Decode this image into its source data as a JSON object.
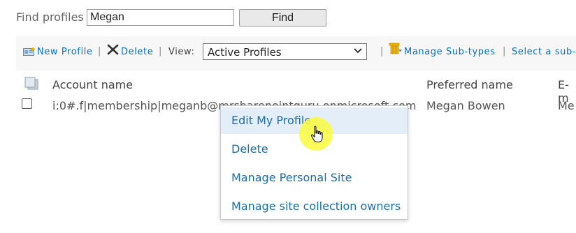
{
  "find": {
    "label": "Find profiles",
    "value": "Megan",
    "button": "Find"
  },
  "toolbar": {
    "new_profile": "New Profile",
    "delete": "Delete",
    "view_label": "View:",
    "view_selected": "Active Profiles",
    "manage_subtypes": "Manage Sub-types",
    "select_subtype": "Select a sub-",
    "separator": "|"
  },
  "table": {
    "headers": [
      "Account name",
      "Preferred name",
      "E-m"
    ],
    "rows": [
      {
        "account": "i:0#.f|membership|meganb@mrsharepointguru.onmicrosoft.com",
        "preferred": "Megan Bowen",
        "email": "Me"
      }
    ]
  },
  "context_menu": {
    "items": [
      "Edit My Profile",
      "Delete",
      "Manage Personal Site",
      "Manage site collection owners"
    ]
  },
  "colors": {
    "link": "#0072c6",
    "menu_link": "#1b6fa8",
    "hover_bg": "#e3eef9",
    "cursor_highlight": "#fafa3c"
  }
}
